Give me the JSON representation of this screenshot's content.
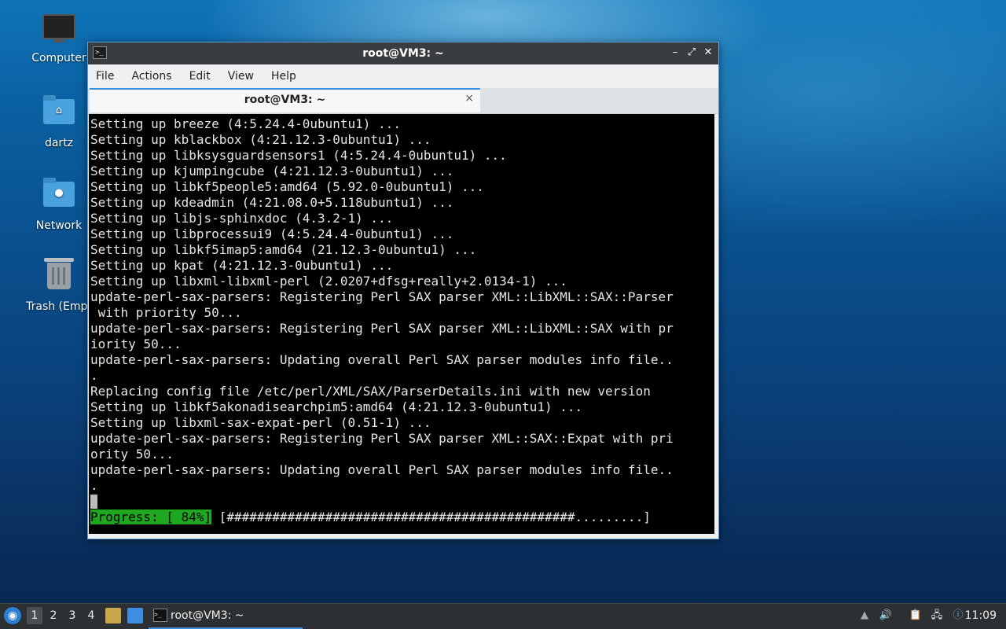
{
  "desktop": {
    "icons": [
      {
        "label": "Computer",
        "icon": "computer-icon"
      },
      {
        "label": "dartz",
        "icon": "home-folder-icon"
      },
      {
        "label": "Network",
        "icon": "network-folder-icon"
      },
      {
        "label": "Trash (Empt",
        "icon": "trash-icon"
      }
    ]
  },
  "window": {
    "title": "root@VM3: ~",
    "menu": [
      "File",
      "Actions",
      "Edit",
      "View",
      "Help"
    ],
    "tab_label": "root@VM3: ~",
    "tab_close": "×"
  },
  "terminal": {
    "lines": [
      "Setting up breeze (4:5.24.4-0ubuntu1) ...",
      "Setting up kblackbox (4:21.12.3-0ubuntu1) ...",
      "Setting up libksysguardsensors1 (4:5.24.4-0ubuntu1) ...",
      "Setting up kjumpingcube (4:21.12.3-0ubuntu1) ...",
      "Setting up libkf5people5:amd64 (5.92.0-0ubuntu1) ...",
      "Setting up kdeadmin (4:21.08.0+5.118ubuntu1) ...",
      "Setting up libjs-sphinxdoc (4.3.2-1) ...",
      "Setting up libprocessui9 (4:5.24.4-0ubuntu1) ...",
      "Setting up libkf5imap5:amd64 (21.12.3-0ubuntu1) ...",
      "Setting up kpat (4:21.12.3-0ubuntu1) ...",
      "Setting up libxml-libxml-perl (2.0207+dfsg+really+2.0134-1) ...",
      "update-perl-sax-parsers: Registering Perl SAX parser XML::LibXML::SAX::Parser",
      " with priority 50...",
      "update-perl-sax-parsers: Registering Perl SAX parser XML::LibXML::SAX with pr",
      "iority 50...",
      "update-perl-sax-parsers: Updating overall Perl SAX parser modules info file..",
      ".",
      "Replacing config file /etc/perl/XML/SAX/ParserDetails.ini with new version",
      "Setting up libkf5akonadisearchpim5:amd64 (4:21.12.3-0ubuntu1) ...",
      "Setting up libxml-sax-expat-perl (0.51-1) ...",
      "update-perl-sax-parsers: Registering Perl SAX parser XML::SAX::Expat with pri",
      "ority 50...",
      "update-perl-sax-parsers: Updating overall Perl SAX parser modules info file..",
      "."
    ],
    "progress_label": "Progress: [ 84%]",
    "progress_bar": " [##############################################.........]",
    "progress_percent": 84
  },
  "taskbar": {
    "workspaces": [
      "1",
      "2",
      "3",
      "4"
    ],
    "active_workspace": "1",
    "task_label": "root@VM3: ~",
    "clock": "11:09"
  },
  "colors": {
    "progress_green": "#1fa81f",
    "accent_blue": "#3d8ee0"
  }
}
